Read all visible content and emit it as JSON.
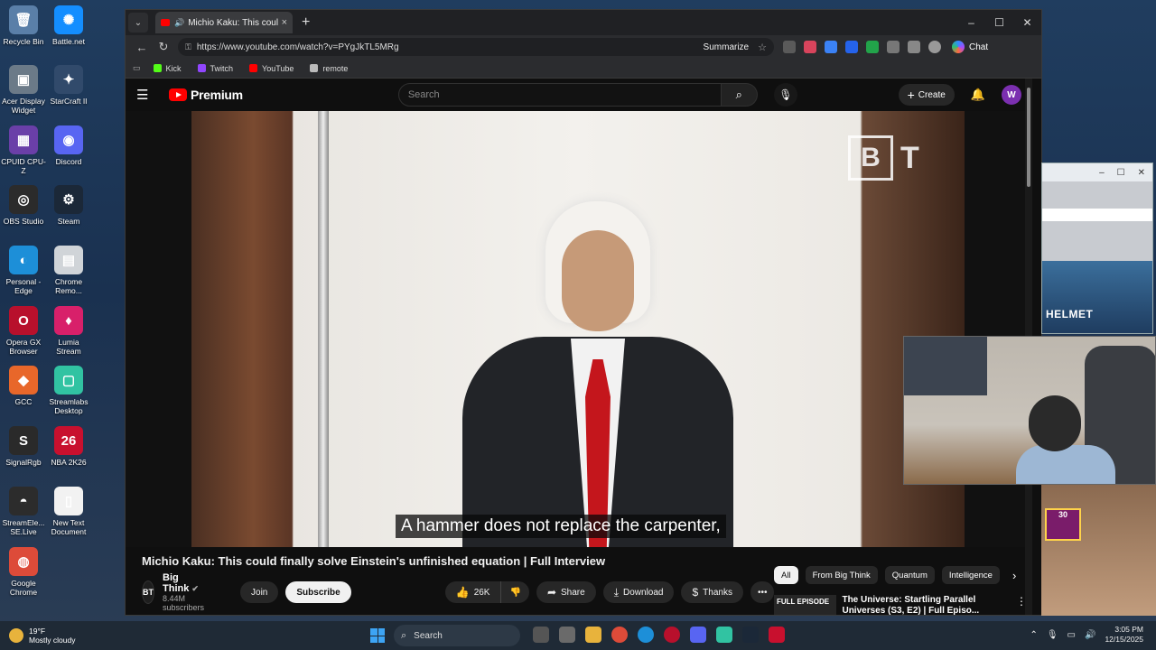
{
  "desktop": {
    "icons": [
      {
        "label": "Recycle Bin",
        "glyph": "🗑",
        "color": "#5a7fa8"
      },
      {
        "label": "Battle.net",
        "glyph": "✺",
        "color": "#148eff"
      },
      {
        "label": "Acer Display Widget",
        "glyph": "▣",
        "color": "#6b7a88"
      },
      {
        "label": "StarCraft II",
        "glyph": "✦",
        "color": "#314a6b"
      },
      {
        "label": "CPUID CPU-Z",
        "glyph": "▦",
        "color": "#6a3fa8"
      },
      {
        "label": "Discord",
        "glyph": "◉",
        "color": "#5865f2"
      },
      {
        "label": "OBS Studio",
        "glyph": "◎",
        "color": "#2b2b2b"
      },
      {
        "label": "Steam",
        "glyph": "⚙",
        "color": "#1b2838"
      },
      {
        "label": "Personal - Edge",
        "glyph": "◐",
        "color": "#1d8fd8"
      },
      {
        "label": "Chrome Remo...",
        "glyph": "▤",
        "color": "#d0d4d8"
      },
      {
        "label": "Opera GX Browser",
        "glyph": "O",
        "color": "#b8102c"
      },
      {
        "label": "Lumia Stream",
        "glyph": "♦",
        "color": "#d8206a"
      },
      {
        "label": "GCC",
        "glyph": "◆",
        "color": "#e8672a"
      },
      {
        "label": "Streamlabs Desktop",
        "glyph": "▢",
        "color": "#31c3a2"
      },
      {
        "label": "SignalRgb",
        "glyph": "S",
        "color": "#2a2a2a"
      },
      {
        "label": "NBA 2K26",
        "glyph": "26",
        "color": "#c8102e"
      },
      {
        "label": "StreamEle... SE.Live",
        "glyph": "◓",
        "color": "#2c2c2c"
      },
      {
        "label": "New Text Document",
        "glyph": "▯",
        "color": "#f2f2f2"
      },
      {
        "label": "Google Chrome",
        "glyph": "◍",
        "color": "#dd4b39"
      }
    ]
  },
  "browser": {
    "tab_title": "Michio Kaku: This could finally",
    "url": "https://www.youtube.com/watch?v=PYgJkTL5MRg",
    "summarize_label": "Summarize",
    "chat_label": "Chat",
    "favorites": [
      {
        "label": "Kick",
        "color": "#53fc18"
      },
      {
        "label": "Twitch",
        "color": "#9146ff"
      },
      {
        "label": "YouTube",
        "color": "#ff0000"
      },
      {
        "label": "remote",
        "color": "#bbbbbb"
      }
    ]
  },
  "youtube": {
    "logo_text": "Premium",
    "search_placeholder": "Search",
    "create_label": "Create",
    "avatar_letter": "W",
    "video": {
      "watermark": "B T",
      "caption": "A hammer does not replace the carpenter,",
      "title": "Michio Kaku: This could finally solve Einstein's unfinished equation | Full Interview"
    },
    "channel": {
      "name": "Big Think",
      "subscribers": "8.44M subscribers",
      "join_label": "Join",
      "subscribe_label": "Subscribe"
    },
    "actions": {
      "likes": "26K",
      "share_label": "Share",
      "download_label": "Download",
      "thanks_label": "Thanks"
    },
    "chips": [
      "All",
      "From Big Think",
      "Quantum",
      "Intelligence"
    ],
    "recommendation": {
      "badge": "FULL EPISODE",
      "title": "The Universe: Startling Parallel Universes (S3, E2) | Full Episo..."
    }
  },
  "overlays": {
    "side_text": "HELMET",
    "badge_number": "30"
  },
  "taskbar": {
    "temperature": "19°F",
    "weather": "Mostly cloudy",
    "search_label": "Search",
    "time": "3:05 PM",
    "date": "12/15/2025"
  }
}
